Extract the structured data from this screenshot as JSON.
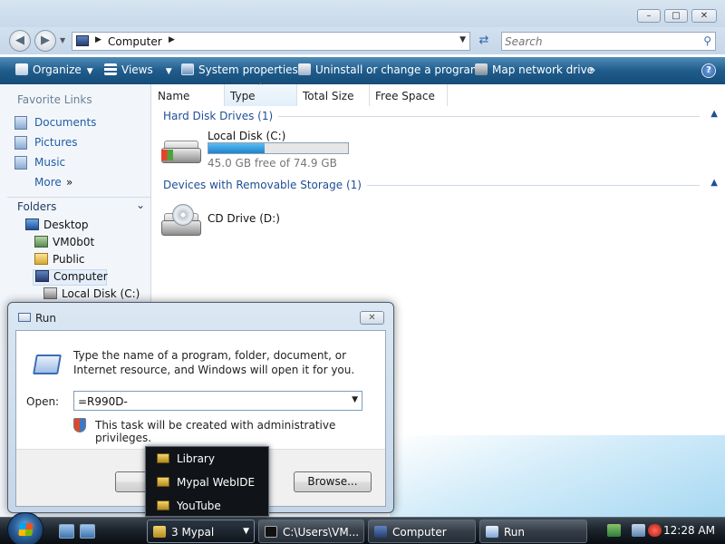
{
  "explorer": {
    "address": {
      "location": "Computer"
    },
    "search": {
      "placeholder": "Search"
    },
    "toolbar": {
      "organize": "Organize",
      "views": "Views",
      "system_properties": "System properties",
      "uninstall": "Uninstall or change a program",
      "map_drive": "Map network drive"
    },
    "nav": {
      "favorite_links_header": "Favorite Links",
      "favorites": [
        "Documents",
        "Pictures",
        "Music",
        "More"
      ],
      "folders_header": "Folders",
      "tree": [
        "Desktop",
        "VM0b0t",
        "Public",
        "Computer",
        "Local Disk (C:)"
      ]
    },
    "columns": [
      "Name",
      "Type",
      "Total Size",
      "Free Space"
    ],
    "groups": {
      "hdd": "Hard Disk Drives (1)",
      "removable": "Devices with Removable Storage (1)"
    },
    "drives": {
      "local_disk": {
        "name": "Local Disk (C:)",
        "free_text": "45.0 GB free of 74.9 GB",
        "used_fraction": 0.4
      },
      "cd_drive": {
        "name": "CD Drive (D:)"
      }
    }
  },
  "run_dialog": {
    "title": "Run",
    "message": "Type the name of a program, folder, document, or Internet resource, and Windows will open it for you.",
    "open_label": "Open:",
    "open_value": "=R990D-",
    "admin_note": "This task will be created with administrative privileges.",
    "browse_button": "Browse..."
  },
  "group_popup": {
    "items": [
      "Library",
      "Mypal WebIDE",
      "YouTube"
    ]
  },
  "taskbar": {
    "tasks": [
      "3 Mypal",
      "C:\\Users\\VM...",
      "Computer",
      "Run"
    ],
    "clock": "12:28 AM"
  },
  "colors": {
    "toolbar": "#1f5c8c",
    "link": "#1f5da4",
    "progress": "#1d84cc",
    "taskbar": "#1c242c"
  }
}
